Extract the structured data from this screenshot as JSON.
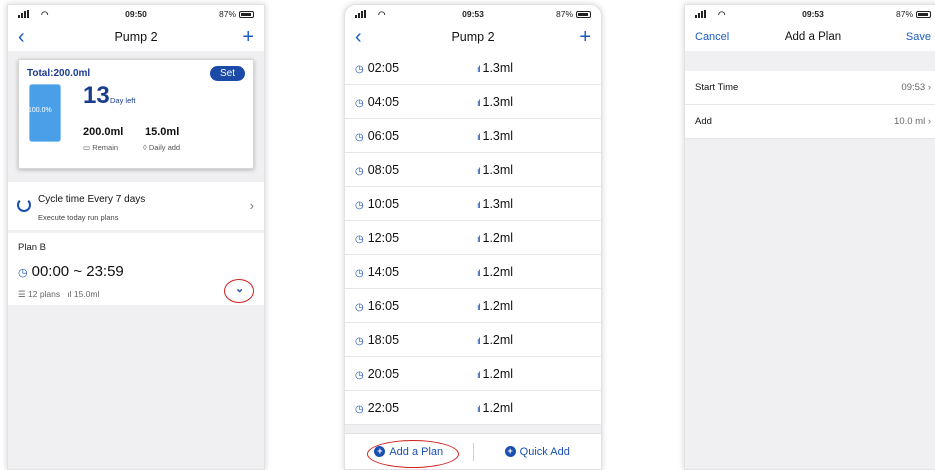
{
  "status": {
    "phone1_time": "09:50",
    "phone1_battery": "87%",
    "phone2_time": "09:53",
    "phone2_battery": "87%",
    "phone3_time": "09:53",
    "phone3_battery": "87%"
  },
  "pump_detail": {
    "title": "Pump 2",
    "total": "Total:200.0ml",
    "set_label": "Set",
    "bottle_percent": "100.0%",
    "days_left": "13",
    "days_left_label": "Day left",
    "remain_value": "200.0ml",
    "remain_label": "Remain",
    "daily_add_value": "15.0ml",
    "daily_add_label": "Daily add",
    "cycle_title": "Cycle time   Every 7 days",
    "cycle_sub": "Execute today run plans",
    "plan_name": "Plan B",
    "plan_time": "00:00 ~ 23:59",
    "plan_count": "12 plans",
    "plan_amount": "15.0ml"
  },
  "schedule": {
    "title": "Pump 2",
    "rows": [
      {
        "time": "02:05",
        "amount": "1.3ml"
      },
      {
        "time": "04:05",
        "amount": "1.3ml"
      },
      {
        "time": "06:05",
        "amount": "1.3ml"
      },
      {
        "time": "08:05",
        "amount": "1.3ml"
      },
      {
        "time": "10:05",
        "amount": "1.3ml"
      },
      {
        "time": "12:05",
        "amount": "1.2ml"
      },
      {
        "time": "14:05",
        "amount": "1.2ml"
      },
      {
        "time": "16:05",
        "amount": "1.2ml"
      },
      {
        "time": "18:05",
        "amount": "1.2ml"
      },
      {
        "time": "20:05",
        "amount": "1.2ml"
      },
      {
        "time": "22:05",
        "amount": "1.2ml"
      }
    ],
    "add_plan_label": "Add a Plan",
    "quick_add_label": "Quick Add"
  },
  "add_plan": {
    "cancel_label": "Cancel",
    "title": "Add a Plan",
    "save_label": "Save",
    "start_time_label": "Start Time",
    "start_time_value": "09:53",
    "add_label": "Add",
    "add_value": "10.0 ml"
  },
  "colors": {
    "accent": "#1a4fb0",
    "highlight": "#d0201a",
    "bottle": "#4aa0e8"
  }
}
